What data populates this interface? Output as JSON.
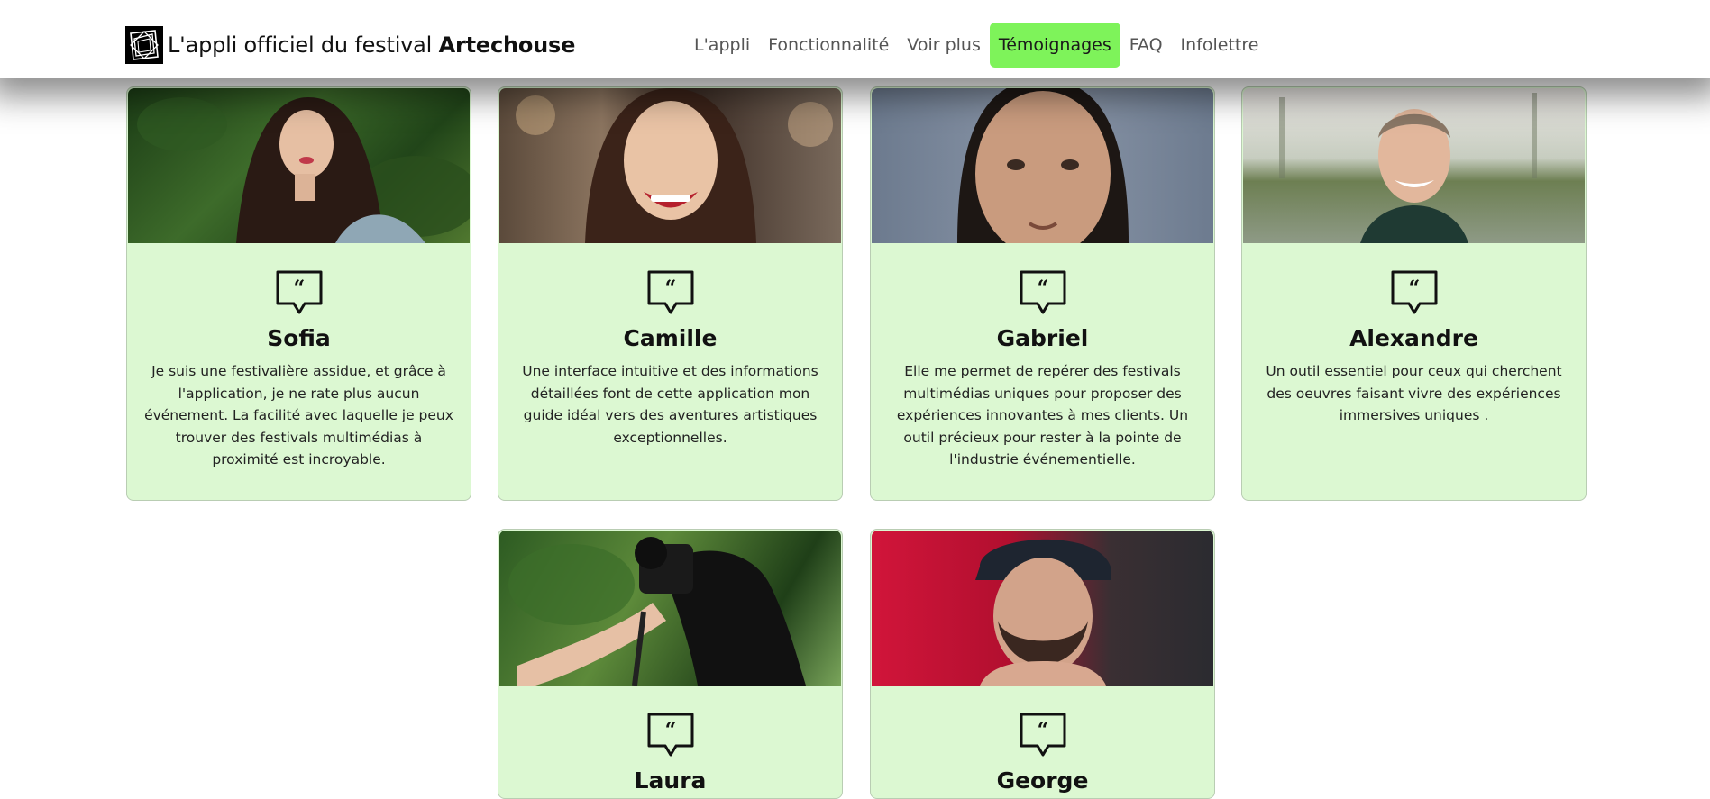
{
  "header": {
    "brand_prefix": "L'appli officiel du festival ",
    "brand_name": "Artechouse",
    "nav": [
      {
        "label": "L'appli",
        "active": false
      },
      {
        "label": "Fonctionnalité",
        "active": false
      },
      {
        "label": "Voir plus",
        "active": false
      },
      {
        "label": "Témoignages",
        "active": true
      },
      {
        "label": "FAQ",
        "active": false
      },
      {
        "label": "Infolettre",
        "active": false
      }
    ]
  },
  "colors": {
    "accent": "#7ef35a",
    "card_bg": "#dcf8d2",
    "card_border": "#b9cdb3"
  },
  "testimonials": [
    {
      "name": "Sofia",
      "icon": "quote-bubble-icon",
      "text": "Je suis une festivalière assidue, et grâce à l'application, je ne rate plus aucun événement. La facilité avec laquelle je peux trouver des festivals multimédias à proximité est incroyable."
    },
    {
      "name": "Camille",
      "icon": "quote-bubble-icon",
      "text": "Une interface intuitive et des informations détaillées font de cette application mon guide idéal vers des aventures artistiques exceptionnelles."
    },
    {
      "name": "Gabriel",
      "icon": "quote-bubble-icon",
      "text": "Elle me permet de repérer des festivals multimédias uniques pour proposer des expériences innovantes à mes clients. Un outil précieux pour rester à la pointe de l'industrie événementielle."
    },
    {
      "name": "Alexandre",
      "icon": "quote-bubble-icon",
      "text": "Un outil essentiel pour ceux qui cherchent des oeuvres faisant vivre des expériences immersives uniques ."
    },
    {
      "name": "Laura",
      "icon": "quote-bubble-icon",
      "text": ""
    },
    {
      "name": "George",
      "icon": "quote-bubble-icon",
      "text": ""
    }
  ]
}
